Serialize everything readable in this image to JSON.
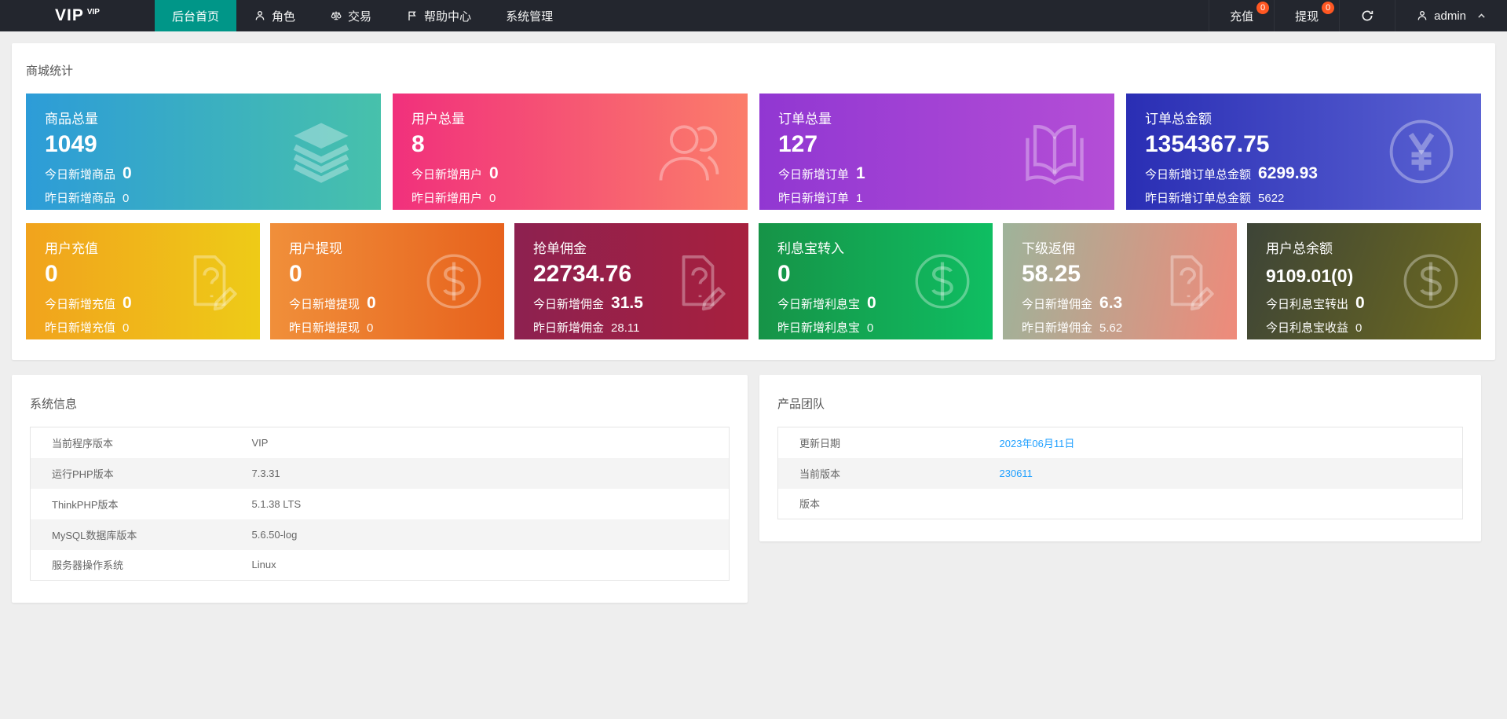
{
  "colors": {
    "accent": "#009688",
    "navbar_bg": "#23262e",
    "badge": "#ff5722",
    "link": "#1e9fff",
    "page_bg": "#eeeeee"
  },
  "navbar": {
    "logo": "VIP",
    "logo_sup": "VIP",
    "menu": [
      {
        "label": "后台首页",
        "active": true,
        "icon": ""
      },
      {
        "label": "角色",
        "icon": "user-icon"
      },
      {
        "label": "交易",
        "icon": "scales-icon"
      },
      {
        "label": "帮助中心",
        "icon": "flag-icon"
      },
      {
        "label": "系统管理",
        "icon": ""
      }
    ],
    "right": {
      "recharge_label": "充值",
      "recharge_badge": "0",
      "withdraw_label": "提现",
      "withdraw_badge": "0",
      "refresh_icon": "refresh-icon",
      "user_label": "admin",
      "user_icon": "user-icon"
    }
  },
  "stats": {
    "title": "商城统计",
    "cards": [
      {
        "title": "商品总量",
        "value": "1049",
        "today_label": "今日新增商品",
        "today_value": "0",
        "yest_label": "昨日新增商品",
        "yest_value": "0",
        "icon": "layers-icon",
        "angle": "90deg",
        "gradient": [
          "#2d9cd8",
          "#47c1ab"
        ]
      },
      {
        "title": "用户总量",
        "value": "8",
        "today_label": "今日新增用户",
        "today_value": "0",
        "yest_label": "昨日新增用户",
        "yest_value": "0",
        "icon": "users-icon",
        "angle": "90deg",
        "gradient": [
          "#f1307c",
          "#fb7d6a"
        ]
      },
      {
        "title": "订单总量",
        "value": "127",
        "today_label": "今日新增订单",
        "today_value": "1",
        "yest_label": "昨日新增订单",
        "yest_value": "1",
        "icon": "book-icon",
        "angle": "90deg",
        "gradient": [
          "#9137d2",
          "#b44ed6"
        ]
      },
      {
        "title": "订单总金额",
        "value": "1354367.75",
        "today_label": "今日新增订单总金额",
        "today_value": "6299.93",
        "yest_label": "昨日新增订单总金额",
        "yest_value": "5622",
        "icon": "yen-circle-icon",
        "angle": "90deg",
        "gradient": [
          "#2a2eb4",
          "#5b63d3"
        ]
      },
      {
        "title": "用户充值",
        "value": "0",
        "today_label": "今日新增充值",
        "today_value": "0",
        "yest_label": "昨日新增充值",
        "yest_value": "0",
        "icon": "doc-question-icon",
        "angle": "90deg",
        "gradient": [
          "#f1a31d",
          "#eecb17"
        ]
      },
      {
        "title": "用户提现",
        "value": "0",
        "today_label": "今日新增提现",
        "today_value": "0",
        "yest_label": "昨日新增提现",
        "yest_value": "0",
        "icon": "dollar-circle-icon",
        "angle": "90deg",
        "gradient": [
          "#f08f3a",
          "#e7621d"
        ]
      },
      {
        "title": "抢单佣金",
        "value": "22734.76",
        "today_label": "今日新增佣金",
        "today_value": "31.5",
        "yest_label": "昨日新增佣金",
        "yest_value": "28.11",
        "icon": "doc-question-icon",
        "angle": "90deg",
        "gradient": [
          "#8d2150",
          "#a7203e"
        ]
      },
      {
        "title": "利息宝转入",
        "value": "0",
        "today_label": "今日新增利息宝",
        "today_value": "0",
        "yest_label": "昨日新增利息宝",
        "yest_value": "0",
        "icon": "dollar-circle-icon",
        "angle": "90deg",
        "gradient": [
          "#169347",
          "#0fbe62"
        ]
      },
      {
        "title": "下级返佣",
        "value": "58.25",
        "today_label": "今日新增佣金",
        "today_value": "6.3",
        "yest_label": "昨日新增佣金",
        "yest_value": "5.62",
        "icon": "doc-question-icon",
        "angle": "100deg",
        "gradient": [
          "#9eb39a",
          "#ef8a7a"
        ]
      },
      {
        "title": "用户总余额",
        "value": "9109.01(0)",
        "today_label": "今日利息宝转出",
        "today_value": "0",
        "yest_label": "今日利息宝收益",
        "yest_value": "0",
        "icon": "dollar-circle-icon",
        "angle": "110deg",
        "gradient": [
          "#3d4437",
          "#6e6a1e"
        ]
      }
    ]
  },
  "system_info": {
    "title": "系统信息",
    "rows": [
      {
        "label": "当前程序版本",
        "value": "VIP"
      },
      {
        "label": "运行PHP版本",
        "value": "7.3.31"
      },
      {
        "label": "ThinkPHP版本",
        "value": "5.1.38 LTS"
      },
      {
        "label": "MySQL数据库版本",
        "value": "5.6.50-log"
      },
      {
        "label": "服务器操作系统",
        "value": "Linux"
      }
    ]
  },
  "product_team": {
    "title": "产品团队",
    "rows": [
      {
        "label": "更新日期",
        "value": "2023年06月11日",
        "link": true
      },
      {
        "label": "当前版本",
        "value": "230611",
        "link": true
      },
      {
        "label": "版本",
        "value": "",
        "link": false
      }
    ]
  }
}
